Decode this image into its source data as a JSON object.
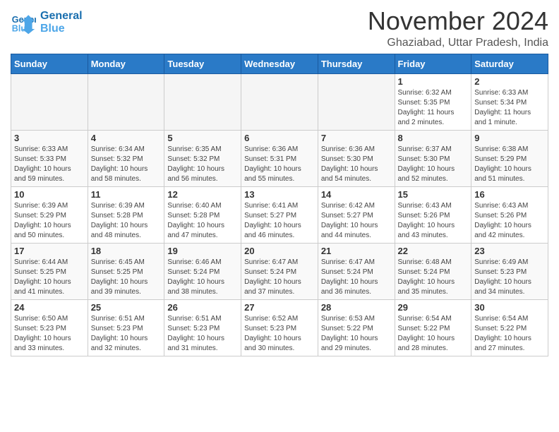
{
  "header": {
    "logo_line1": "General",
    "logo_line2": "Blue",
    "month": "November 2024",
    "location": "Ghaziabad, Uttar Pradesh, India"
  },
  "weekdays": [
    "Sunday",
    "Monday",
    "Tuesday",
    "Wednesday",
    "Thursday",
    "Friday",
    "Saturday"
  ],
  "weeks": [
    [
      {
        "day": "",
        "info": ""
      },
      {
        "day": "",
        "info": ""
      },
      {
        "day": "",
        "info": ""
      },
      {
        "day": "",
        "info": ""
      },
      {
        "day": "",
        "info": ""
      },
      {
        "day": "1",
        "info": "Sunrise: 6:32 AM\nSunset: 5:35 PM\nDaylight: 11 hours\nand 2 minutes."
      },
      {
        "day": "2",
        "info": "Sunrise: 6:33 AM\nSunset: 5:34 PM\nDaylight: 11 hours\nand 1 minute."
      }
    ],
    [
      {
        "day": "3",
        "info": "Sunrise: 6:33 AM\nSunset: 5:33 PM\nDaylight: 10 hours\nand 59 minutes."
      },
      {
        "day": "4",
        "info": "Sunrise: 6:34 AM\nSunset: 5:32 PM\nDaylight: 10 hours\nand 58 minutes."
      },
      {
        "day": "5",
        "info": "Sunrise: 6:35 AM\nSunset: 5:32 PM\nDaylight: 10 hours\nand 56 minutes."
      },
      {
        "day": "6",
        "info": "Sunrise: 6:36 AM\nSunset: 5:31 PM\nDaylight: 10 hours\nand 55 minutes."
      },
      {
        "day": "7",
        "info": "Sunrise: 6:36 AM\nSunset: 5:30 PM\nDaylight: 10 hours\nand 54 minutes."
      },
      {
        "day": "8",
        "info": "Sunrise: 6:37 AM\nSunset: 5:30 PM\nDaylight: 10 hours\nand 52 minutes."
      },
      {
        "day": "9",
        "info": "Sunrise: 6:38 AM\nSunset: 5:29 PM\nDaylight: 10 hours\nand 51 minutes."
      }
    ],
    [
      {
        "day": "10",
        "info": "Sunrise: 6:39 AM\nSunset: 5:29 PM\nDaylight: 10 hours\nand 50 minutes."
      },
      {
        "day": "11",
        "info": "Sunrise: 6:39 AM\nSunset: 5:28 PM\nDaylight: 10 hours\nand 48 minutes."
      },
      {
        "day": "12",
        "info": "Sunrise: 6:40 AM\nSunset: 5:28 PM\nDaylight: 10 hours\nand 47 minutes."
      },
      {
        "day": "13",
        "info": "Sunrise: 6:41 AM\nSunset: 5:27 PM\nDaylight: 10 hours\nand 46 minutes."
      },
      {
        "day": "14",
        "info": "Sunrise: 6:42 AM\nSunset: 5:27 PM\nDaylight: 10 hours\nand 44 minutes."
      },
      {
        "day": "15",
        "info": "Sunrise: 6:43 AM\nSunset: 5:26 PM\nDaylight: 10 hours\nand 43 minutes."
      },
      {
        "day": "16",
        "info": "Sunrise: 6:43 AM\nSunset: 5:26 PM\nDaylight: 10 hours\nand 42 minutes."
      }
    ],
    [
      {
        "day": "17",
        "info": "Sunrise: 6:44 AM\nSunset: 5:25 PM\nDaylight: 10 hours\nand 41 minutes."
      },
      {
        "day": "18",
        "info": "Sunrise: 6:45 AM\nSunset: 5:25 PM\nDaylight: 10 hours\nand 39 minutes."
      },
      {
        "day": "19",
        "info": "Sunrise: 6:46 AM\nSunset: 5:24 PM\nDaylight: 10 hours\nand 38 minutes."
      },
      {
        "day": "20",
        "info": "Sunrise: 6:47 AM\nSunset: 5:24 PM\nDaylight: 10 hours\nand 37 minutes."
      },
      {
        "day": "21",
        "info": "Sunrise: 6:47 AM\nSunset: 5:24 PM\nDaylight: 10 hours\nand 36 minutes."
      },
      {
        "day": "22",
        "info": "Sunrise: 6:48 AM\nSunset: 5:24 PM\nDaylight: 10 hours\nand 35 minutes."
      },
      {
        "day": "23",
        "info": "Sunrise: 6:49 AM\nSunset: 5:23 PM\nDaylight: 10 hours\nand 34 minutes."
      }
    ],
    [
      {
        "day": "24",
        "info": "Sunrise: 6:50 AM\nSunset: 5:23 PM\nDaylight: 10 hours\nand 33 minutes."
      },
      {
        "day": "25",
        "info": "Sunrise: 6:51 AM\nSunset: 5:23 PM\nDaylight: 10 hours\nand 32 minutes."
      },
      {
        "day": "26",
        "info": "Sunrise: 6:51 AM\nSunset: 5:23 PM\nDaylight: 10 hours\nand 31 minutes."
      },
      {
        "day": "27",
        "info": "Sunrise: 6:52 AM\nSunset: 5:23 PM\nDaylight: 10 hours\nand 30 minutes."
      },
      {
        "day": "28",
        "info": "Sunrise: 6:53 AM\nSunset: 5:22 PM\nDaylight: 10 hours\nand 29 minutes."
      },
      {
        "day": "29",
        "info": "Sunrise: 6:54 AM\nSunset: 5:22 PM\nDaylight: 10 hours\nand 28 minutes."
      },
      {
        "day": "30",
        "info": "Sunrise: 6:54 AM\nSunset: 5:22 PM\nDaylight: 10 hours\nand 27 minutes."
      }
    ]
  ]
}
